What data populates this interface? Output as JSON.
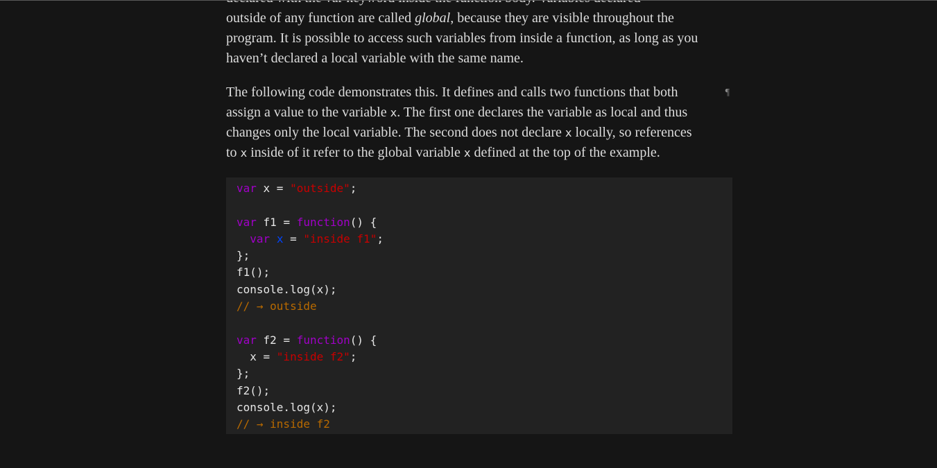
{
  "paragraphs": {
    "p1": {
      "line0": "declared with the var keyword inside the function body. Variables declared",
      "t1": "outside of any function are called ",
      "em": "global",
      "t2": ", because they are visible throughout the program. It is possible to access such variables from inside a function, as long as you haven’t declared a local variable with the same name."
    },
    "p2": {
      "t1": "The following code demonstrates this. It defines and calls two functions that both assign a value to the variable ",
      "c1": "x",
      "t2": ". The first one declares the variable as local and thus changes only the local variable. The second does not declare ",
      "c2": "x",
      "t3": " locally, so references to ",
      "c3": "x",
      "t4": " inside of it refer to the global variable ",
      "c4": "x",
      "t5": " defined at the top of the example.",
      "pilcrow": "¶"
    }
  },
  "code": {
    "l1_kw": "var",
    "l1_rest": " x = ",
    "l1_str": "\"outside\"",
    "l1_end": ";",
    "l3_kw": "var",
    "l3_rest": " f1 = ",
    "l3_kw2": "function",
    "l3_end": "() {",
    "l4_indent": "  ",
    "l4_kw": "var",
    "l4_sp": " ",
    "l4_var": "x",
    "l4_eq": " = ",
    "l4_str": "\"inside f1\"",
    "l4_end": ";",
    "l5": "};",
    "l6": "f1();",
    "l7_a": "console.",
    "l7_prop": "log",
    "l7_b": "(x);",
    "l8": "// → outside",
    "l10_kw": "var",
    "l10_rest": " f2 = ",
    "l10_kw2": "function",
    "l10_end": "() {",
    "l11_a": "  x = ",
    "l11_str": "\"inside f2\"",
    "l11_end": ";",
    "l12": "};",
    "l13": "f2();",
    "l14_a": "console.",
    "l14_prop": "log",
    "l14_b": "(x);",
    "l15": "// → inside f2"
  },
  "colors": {
    "background": "#151515",
    "text": "#dcdcdc",
    "code_bg": "#222222",
    "keyword": "#a100c8",
    "string": "#c80000",
    "variable_def": "#0044ff",
    "comment": "#b86a00"
  }
}
